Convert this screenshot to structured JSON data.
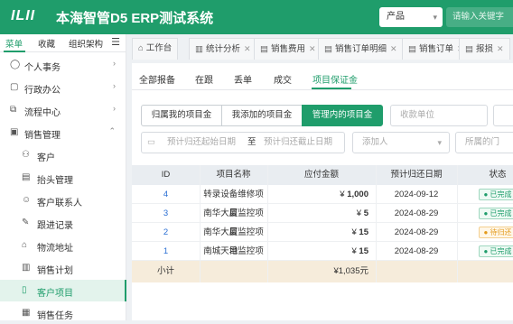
{
  "header": {
    "logo": "ILII",
    "title": "本海智管D5 ERP测试系统",
    "product_select": "产品",
    "search_placeholder": "请输入关键字"
  },
  "sidebar": {
    "tabs": [
      "菜单",
      "收藏",
      "组织架构"
    ],
    "items": [
      {
        "label": "个人事务",
        "icon": "person-icon",
        "level": 1,
        "expanded": false
      },
      {
        "label": "行政办公",
        "icon": "briefcase-icon",
        "level": 1,
        "expanded": false
      },
      {
        "label": "流程中心",
        "icon": "flow-icon",
        "level": 1,
        "expanded": false
      },
      {
        "label": "销售管理",
        "icon": "sales-icon",
        "level": 1,
        "expanded": true
      },
      {
        "label": "客户",
        "icon": "customer-icon",
        "level": 2
      },
      {
        "label": "抬头管理",
        "icon": "document-icon",
        "level": 2
      },
      {
        "label": "客户联系人",
        "icon": "contact-icon",
        "level": 2
      },
      {
        "label": "跟进记录",
        "icon": "record-icon",
        "level": 2
      },
      {
        "label": "物流地址",
        "icon": "location-icon",
        "level": 2
      },
      {
        "label": "销售计划",
        "icon": "plan-icon",
        "level": 2
      },
      {
        "label": "客户项目",
        "icon": "file-icon",
        "level": 2,
        "active": true
      },
      {
        "label": "销售任务",
        "icon": "task-icon",
        "level": 2
      }
    ]
  },
  "tabs": [
    {
      "label": "工作台",
      "icon": "home-icon"
    },
    {
      "label": "统计分析",
      "icon": "chart-icon"
    },
    {
      "label": "销售费用",
      "icon": "doc-icon"
    },
    {
      "label": "销售订单明细",
      "icon": "doc-icon"
    },
    {
      "label": "销售订单",
      "icon": "doc-icon"
    },
    {
      "label": "报损",
      "icon": "doc-icon"
    }
  ],
  "filter_tabs": [
    "全部报备",
    "在跟",
    "丢单",
    "成交",
    "项目保证金"
  ],
  "segments": [
    "归属我的项目金",
    "我添加的项目金",
    "管理内的项目金"
  ],
  "filters": {
    "unit_placeholder": "收款单位",
    "date_from": "预计归还起始日期",
    "date_sep": "至",
    "date_to": "预计归还截止日期",
    "adder_placeholder": "添加人",
    "dept_placeholder": "所属的门"
  },
  "table": {
    "columns": [
      "ID",
      "项目名称",
      "应付金额",
      "预计归还日期",
      "状态"
    ],
    "rows": [
      {
        "id": "4",
        "name": "转录设备维修项目",
        "amount": "1,000",
        "date": "2024-09-12",
        "status": "已完成",
        "status_type": "done"
      },
      {
        "id": "3",
        "name": "南华大厦监控项目",
        "amount": "5",
        "date": "2024-08-29",
        "status": "已完成",
        "status_type": "done"
      },
      {
        "id": "2",
        "name": "南华大厦监控项目",
        "amount": "15",
        "date": "2024-08-29",
        "status": "待归还",
        "status_type": "pending"
      },
      {
        "id": "1",
        "name": "南城天地监控项目",
        "amount": "15",
        "date": "2024-08-29",
        "status": "已完成",
        "status_type": "done"
      }
    ],
    "currency": "¥",
    "subtotal_label": "小计",
    "subtotal_value": "¥1,035元"
  },
  "colors": {
    "accent": "#1f9d6b",
    "link": "#2b6fd4",
    "pending": "#e39a1a"
  }
}
